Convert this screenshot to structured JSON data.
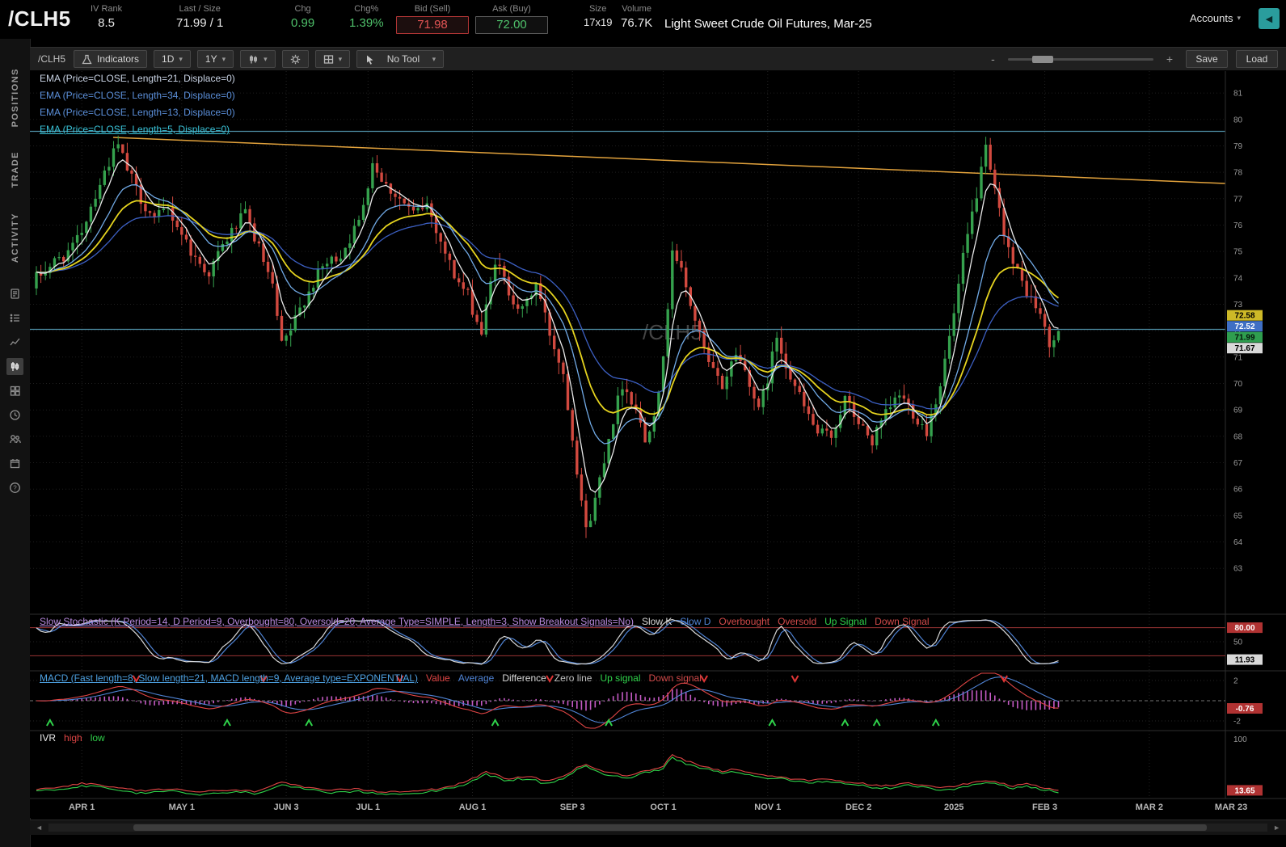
{
  "header": {
    "symbol": "/CLH5",
    "fields": [
      {
        "label": "IV Rank",
        "value": "8.5"
      },
      {
        "label": "Last / Size",
        "value": "71.99 / 1"
      },
      {
        "label": "Chg",
        "value": "0.99"
      },
      {
        "label": "Chg%",
        "value": "1.39%"
      },
      {
        "label": "Bid (Sell)",
        "value": "71.98"
      },
      {
        "label": "Ask (Buy)",
        "value": "72.00"
      },
      {
        "label": "Size",
        "value": "17x19"
      },
      {
        "label": "Volume",
        "value": "76.7K"
      }
    ],
    "description": "Light Sweet Crude Oil Futures, Mar-25",
    "accounts_label": "Accounts"
  },
  "sidebar": {
    "tabs": [
      "POSITIONS",
      "TRADE",
      "ACTIVITY"
    ]
  },
  "toolbar": {
    "symbol": "/CLH5",
    "indicators_label": "Indicators",
    "timeframe": "1D",
    "range": "1Y",
    "tool_label": "No Tool",
    "zoom_out": "-",
    "zoom_in": "+",
    "save_label": "Save",
    "load_label": "Load"
  },
  "studies": {
    "ema_labels": [
      {
        "t": "EMA (Price=CLOSE, Length=21, Displace=0)",
        "c": "#c9d3e4",
        "u": false
      },
      {
        "t": "EMA (Price=CLOSE, Length=34, Displace=0)",
        "c": "#5b8fd9",
        "u": false
      },
      {
        "t": "EMA (Price=CLOSE, Length=13, Displace=0)",
        "c": "#5b8fd9",
        "u": false
      },
      {
        "t": "EMA (Price=CLOSE, Length=5, Displace=0)",
        "c": "#39c2d7",
        "u": true
      }
    ],
    "stoch_legend": [
      {
        "t": "Slow Stochastic (K Period=14, D Period=9, Overbought=80, Oversold=20, Average Type=SIMPLE, Length=3, Show Breakout Signals=No)",
        "c": "#b98ae0",
        "u": true
      },
      {
        "t": "Slow K",
        "c": "#d9d9d9",
        "u": false
      },
      {
        "t": "Slow D",
        "c": "#4f83d4",
        "u": false
      },
      {
        "t": "Overbought",
        "c": "#d24a4a",
        "u": false
      },
      {
        "t": "Oversold",
        "c": "#d24a4a",
        "u": false
      },
      {
        "t": "Up Signal",
        "c": "#2fd24a",
        "u": false
      },
      {
        "t": "Down Signal",
        "c": "#d24a4a",
        "u": false
      }
    ],
    "macd_legend": [
      {
        "t": "MACD (Fast length=8, Slow length=21, MACD length=9, Average type=EXPONENTIAL)",
        "c": "#4da0e0",
        "u": true
      },
      {
        "t": "Value",
        "c": "#e04545",
        "u": false
      },
      {
        "t": "Average",
        "c": "#4f83d4",
        "u": false
      },
      {
        "t": "Difference",
        "c": "#d9d9d9",
        "u": false
      },
      {
        "t": "Zero line",
        "c": "#bfbfbf",
        "u": false
      },
      {
        "t": "Up signal",
        "c": "#2fd24a",
        "u": false
      },
      {
        "t": "Down signal",
        "c": "#d24a4a",
        "u": false
      }
    ],
    "ivr_legend": [
      {
        "t": "IVR",
        "c": "#e8e8e8",
        "u": false
      },
      {
        "t": "high",
        "c": "#e04545",
        "u": false
      },
      {
        "t": "low",
        "c": "#2fd24a",
        "u": false
      }
    ]
  },
  "chart_data": {
    "type": "candlestick",
    "title": "/CLH5 Light Sweet Crude Oil Futures, Mar-25, 1D 1Y",
    "symbol_watermark": "/CLH5",
    "last_price": 71.99,
    "num_bars": 226,
    "price_axis": {
      "ticks": [
        81,
        80,
        79,
        78,
        77,
        76,
        75,
        74,
        73,
        72,
        71,
        70,
        69,
        68,
        67,
        66,
        65,
        64,
        63
      ],
      "boxes": [
        {
          "v": 72.58,
          "label": "72.58",
          "bg": "#cdb927",
          "fg": "#000000"
        },
        {
          "v": 72.52,
          "label": "72.52",
          "bg": "#3f6fc4",
          "fg": "#ffffff"
        },
        {
          "v": 71.99,
          "label": "71.99",
          "bg": "#2f9e4f",
          "fg": "#04130a"
        },
        {
          "v": 71.67,
          "label": "71.67",
          "bg": "#d9d9d9",
          "fg": "#000000"
        }
      ]
    },
    "x_axis": {
      "labels": [
        {
          "t": "APR 1",
          "d": 10
        },
        {
          "t": "MAY 1",
          "d": 32
        },
        {
          "t": "JUN 3",
          "d": 55
        },
        {
          "t": "JUL 1",
          "d": 73
        },
        {
          "t": "AUG 1",
          "d": 96
        },
        {
          "t": "SEP 3",
          "d": 118
        },
        {
          "t": "OCT 1",
          "d": 138
        },
        {
          "t": "NOV 1",
          "d": 161
        },
        {
          "t": "DEC 2",
          "d": 181
        },
        {
          "t": "2025",
          "d": 202
        },
        {
          "t": "FEB 3",
          "d": 222
        },
        {
          "t": "MAR 2",
          "d": 245
        },
        {
          "t": "MAR 23",
          "d": 263
        }
      ]
    },
    "close_anchors": [
      [
        0,
        74.0
      ],
      [
        4,
        74.6
      ],
      [
        8,
        75.1
      ],
      [
        10,
        75.8
      ],
      [
        13,
        77.2
      ],
      [
        16,
        78.4
      ],
      [
        18,
        79.0
      ],
      [
        20,
        78.1
      ],
      [
        23,
        77.0
      ],
      [
        26,
        76.2
      ],
      [
        29,
        76.6
      ],
      [
        32,
        75.7
      ],
      [
        35,
        74.7
      ],
      [
        38,
        74.2
      ],
      [
        41,
        75.2
      ],
      [
        44,
        76.0
      ],
      [
        46,
        76.4
      ],
      [
        49,
        75.1
      ],
      [
        52,
        73.6
      ],
      [
        54,
        71.4
      ],
      [
        56,
        72.0
      ],
      [
        59,
        73.2
      ],
      [
        63,
        74.4
      ],
      [
        67,
        74.9
      ],
      [
        71,
        76.1
      ],
      [
        74,
        78.4
      ],
      [
        77,
        77.5
      ],
      [
        80,
        77.0
      ],
      [
        83,
        76.4
      ],
      [
        86,
        76.8
      ],
      [
        89,
        75.4
      ],
      [
        92,
        74.1
      ],
      [
        95,
        73.3
      ],
      [
        98,
        71.9
      ],
      [
        101,
        74.7
      ],
      [
        104,
        73.5
      ],
      [
        107,
        72.7
      ],
      [
        110,
        73.8
      ],
      [
        113,
        71.9
      ],
      [
        116,
        70.4
      ],
      [
        119,
        66.8
      ],
      [
        121,
        64.4
      ],
      [
        123,
        65.6
      ],
      [
        126,
        68.0
      ],
      [
        129,
        70.0
      ],
      [
        132,
        69.1
      ],
      [
        134,
        67.8
      ],
      [
        136,
        69.0
      ],
      [
        138,
        70.8
      ],
      [
        140,
        75.2
      ],
      [
        142,
        74.2
      ],
      [
        145,
        72.4
      ],
      [
        148,
        70.7
      ],
      [
        151,
        69.9
      ],
      [
        154,
        71.2
      ],
      [
        157,
        70.1
      ],
      [
        159,
        68.9
      ],
      [
        161,
        70.2
      ],
      [
        163,
        71.8
      ],
      [
        166,
        70.3
      ],
      [
        169,
        69.1
      ],
      [
        172,
        68.1
      ],
      [
        175,
        68.0
      ],
      [
        178,
        69.4
      ],
      [
        181,
        68.5
      ],
      [
        184,
        67.8
      ],
      [
        187,
        68.8
      ],
      [
        190,
        69.6
      ],
      [
        193,
        68.9
      ],
      [
        196,
        68.2
      ],
      [
        199,
        70.0
      ],
      [
        202,
        72.6
      ],
      [
        204,
        74.7
      ],
      [
        206,
        76.4
      ],
      [
        209,
        78.8
      ],
      [
        211,
        77.2
      ],
      [
        213,
        75.8
      ],
      [
        215,
        74.5
      ],
      [
        217,
        73.8
      ],
      [
        219,
        73.2
      ],
      [
        221,
        72.6
      ],
      [
        223,
        71.4
      ],
      [
        225,
        71.99
      ]
    ],
    "levels": [
      79.55,
      72.05
    ],
    "trendline": {
      "color": "#e2a23c"
    },
    "emas": [
      {
        "length": 34,
        "color": "#3c5fc2"
      },
      {
        "length": 21,
        "color": "#e6d41f"
      },
      {
        "length": 13,
        "color": "#71aae6"
      },
      {
        "length": 5,
        "color": "#e9e9e9"
      }
    ],
    "stochastic": {
      "k_period": 14,
      "d_period": 9,
      "overbought": 80,
      "oversold": 20,
      "axis": {
        "top_label": "80.00",
        "mid_label": "50",
        "value_label": "11.93",
        "value": 11.93
      }
    },
    "macd": {
      "fast": 8,
      "slow": 21,
      "signal": 9,
      "axis": {
        "top_label": "2",
        "bottom_label": "-2",
        "value_label": "-0.76",
        "value": -0.76
      }
    },
    "ivr": {
      "anchors": [
        [
          0,
          16
        ],
        [
          6,
          20
        ],
        [
          10,
          26
        ],
        [
          14,
          22
        ],
        [
          18,
          17
        ],
        [
          24,
          13
        ],
        [
          30,
          16
        ],
        [
          36,
          11
        ],
        [
          42,
          14
        ],
        [
          48,
          12
        ],
        [
          54,
          28
        ],
        [
          58,
          20
        ],
        [
          64,
          13
        ],
        [
          70,
          16
        ],
        [
          76,
          11
        ],
        [
          82,
          13
        ],
        [
          88,
          16
        ],
        [
          92,
          22
        ],
        [
          96,
          34
        ],
        [
          99,
          44
        ],
        [
          101,
          40
        ],
        [
          104,
          32
        ],
        [
          108,
          38
        ],
        [
          112,
          30
        ],
        [
          116,
          36
        ],
        [
          119,
          52
        ],
        [
          121,
          58
        ],
        [
          124,
          48
        ],
        [
          127,
          42
        ],
        [
          130,
          38
        ],
        [
          133,
          44
        ],
        [
          136,
          50
        ],
        [
          138,
          55
        ],
        [
          140,
          75
        ],
        [
          141,
          70
        ],
        [
          143,
          64
        ],
        [
          145,
          58
        ],
        [
          148,
          52
        ],
        [
          151,
          46
        ],
        [
          154,
          50
        ],
        [
          157,
          44
        ],
        [
          160,
          40
        ],
        [
          163,
          36
        ],
        [
          166,
          33
        ],
        [
          170,
          30
        ],
        [
          174,
          33
        ],
        [
          178,
          28
        ],
        [
          181,
          26
        ],
        [
          184,
          23
        ],
        [
          188,
          21
        ],
        [
          192,
          26
        ],
        [
          196,
          21
        ],
        [
          200,
          19
        ],
        [
          203,
          22
        ],
        [
          206,
          27
        ],
        [
          209,
          31
        ],
        [
          212,
          26
        ],
        [
          215,
          21
        ],
        [
          218,
          27
        ],
        [
          221,
          19
        ],
        [
          223,
          16
        ],
        [
          225,
          14
        ]
      ],
      "last": 13.65,
      "axis": {
        "top_label": "100",
        "value_label": "13.65"
      }
    }
  }
}
